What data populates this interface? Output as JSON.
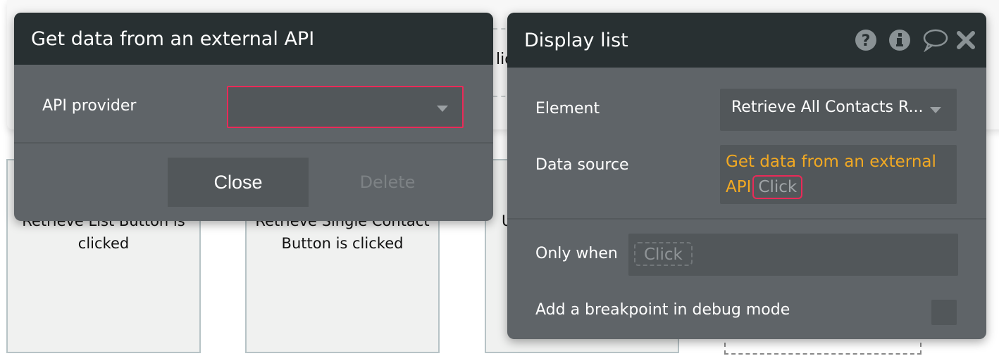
{
  "background": {
    "partial_text": "lic",
    "cards": [
      {
        "text": "Retrieve List Button is clicked"
      },
      {
        "text": "Retrieve Single Contact Button is clicked"
      },
      {
        "text": "U"
      }
    ]
  },
  "left_modal": {
    "title": "Get data from an external API",
    "api_provider_label": "API provider",
    "api_provider_value": "",
    "close_label": "Close",
    "delete_label": "Delete"
  },
  "right_modal": {
    "title": "Display list",
    "icons": [
      "help-icon",
      "info-icon",
      "comment-icon",
      "close-icon"
    ],
    "element_label": "Element",
    "element_value": "Retrieve All Contacts R...",
    "data_source_label": "Data source",
    "data_source_value": "Get data from an external API",
    "data_source_click": "Click",
    "only_when_label": "Only when",
    "only_when_click": "Click",
    "breakpoint_label": "Add a breakpoint in debug mode",
    "breakpoint_checked": false
  },
  "colors": {
    "header_bg": "#283032",
    "body_bg": "#5f6468",
    "field_bg": "#52575a",
    "accent_orange": "#f2a922",
    "error_red": "#ea2a58"
  }
}
